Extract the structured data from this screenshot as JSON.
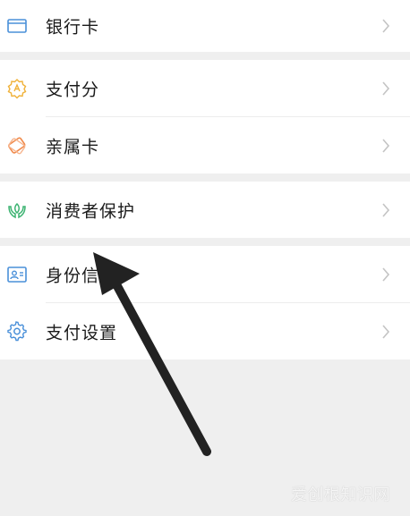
{
  "menu": {
    "bank_card": "银行卡",
    "payscore": "支付分",
    "family_card": "亲属卡",
    "consumer_protection": "消费者保护",
    "identity_info": "身份信",
    "payment_settings": "支付设置"
  },
  "watermark": "爱创根知识网",
  "colors": {
    "blue_icon": "#4a90d9",
    "gold_icon": "#f0b23a",
    "orange_icon": "#f08a4b",
    "green_icon": "#3cb371",
    "chevron": "#c4c4c4",
    "background": "#efefef"
  },
  "icons": {
    "bank_card": "card-icon",
    "payscore": "payscore-badge-icon",
    "family_card": "family-card-icon",
    "consumer_protection": "hands-leaf-icon",
    "identity_info": "id-card-icon",
    "payment_settings": "gear-icon"
  }
}
